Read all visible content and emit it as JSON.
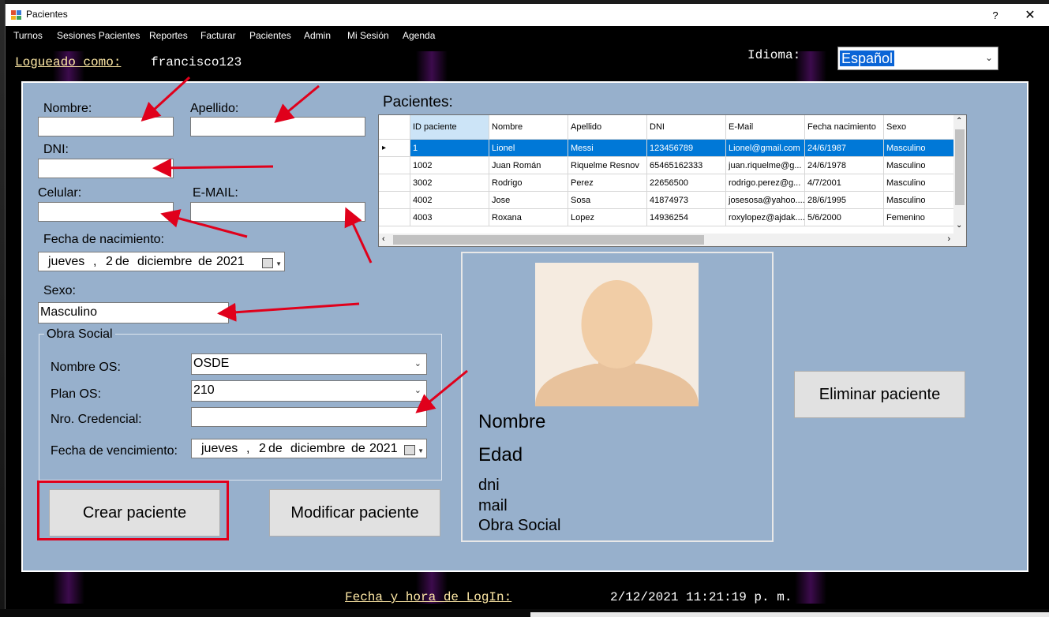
{
  "window": {
    "title": "Pacientes",
    "help": "?",
    "close": "✕"
  },
  "menu": [
    "Turnos",
    "Sesiones Pacientes",
    "Reportes",
    "Facturar",
    "Pacientes",
    "Admin",
    "Mi Sesión",
    "Agenda"
  ],
  "header": {
    "logged_label": "Logueado como:",
    "logged_user": "francisco123",
    "language_label": "Idioma:",
    "language_value": "Español"
  },
  "form": {
    "nombre_label": "Nombre:",
    "nombre_value": "",
    "apellido_label": "Apellido:",
    "apellido_value": "",
    "dni_label": "DNI:",
    "dni_value": "",
    "celular_label": "Celular:",
    "celular_value": "",
    "email_label": "E-MAIL:",
    "email_value": "",
    "fecha_nac_label": "Fecha de nacimiento:",
    "fecha_nac": {
      "weekday": "jueves",
      "sep": ",",
      "day": "2",
      "de1": "de",
      "month": "diciembre",
      "de2": "de",
      "year": "2021"
    },
    "sexo_label": "Sexo:",
    "sexo_value": "Masculino",
    "obra_social": {
      "group_title": "Obra Social",
      "nombre_os_label": "Nombre OS:",
      "nombre_os_value": "OSDE",
      "plan_os_label": "Plan OS:",
      "plan_os_value": "210",
      "credencial_label": "Nro. Credencial:",
      "credencial_value": "",
      "vencimiento_label": "Fecha de vencimiento:",
      "vencimiento": {
        "weekday": "jueves",
        "sep": ",",
        "day": "2",
        "de1": "de",
        "month": "diciembre",
        "de2": "de",
        "year": "2021"
      }
    }
  },
  "buttons": {
    "crear": "Crear paciente",
    "modificar": "Modificar paciente",
    "eliminar": "Eliminar paciente"
  },
  "grid": {
    "title": "Pacientes:",
    "columns": [
      "ID paciente",
      "Nombre",
      "Apellido",
      "DNI",
      "E-Mail",
      "Fecha nacimiento",
      "Sexo"
    ],
    "rows": [
      [
        "1",
        "Lionel",
        "Messi",
        "123456789",
        "Lionel@gmail.com",
        "24/6/1987",
        "Masculino"
      ],
      [
        "1002",
        "Juan Román",
        "Riquelme Resnov",
        "65465162333",
        "juan.riquelme@g...",
        "24/6/1978",
        "Masculino"
      ],
      [
        "3002",
        "Rodrigo",
        "Perez",
        "22656500",
        "rodrigo.perez@g...",
        "4/7/2001",
        "Masculino"
      ],
      [
        "4002",
        "Jose",
        "Sosa",
        "41874973",
        "josesosa@yahoo....",
        "28/6/1995",
        "Masculino"
      ],
      [
        "4003",
        "Roxana",
        "Lopez",
        "14936254",
        "roxylopez@ajdak....",
        "5/6/2000",
        "Femenino"
      ]
    ],
    "selected_row": 0
  },
  "card": {
    "nombre": "Nombre",
    "edad": "Edad",
    "dni": "dni",
    "mail": "mail",
    "obra_social": "Obra Social"
  },
  "footer": {
    "login_label": "Fecha y hora de LogIn:",
    "login_value": "2/12/2021 11:21:19 p. m."
  },
  "colors": {
    "panel": "#97b0cc",
    "selection": "#0078d7",
    "annotation": "#e0001b",
    "underline_label": "#ffe9a6"
  }
}
